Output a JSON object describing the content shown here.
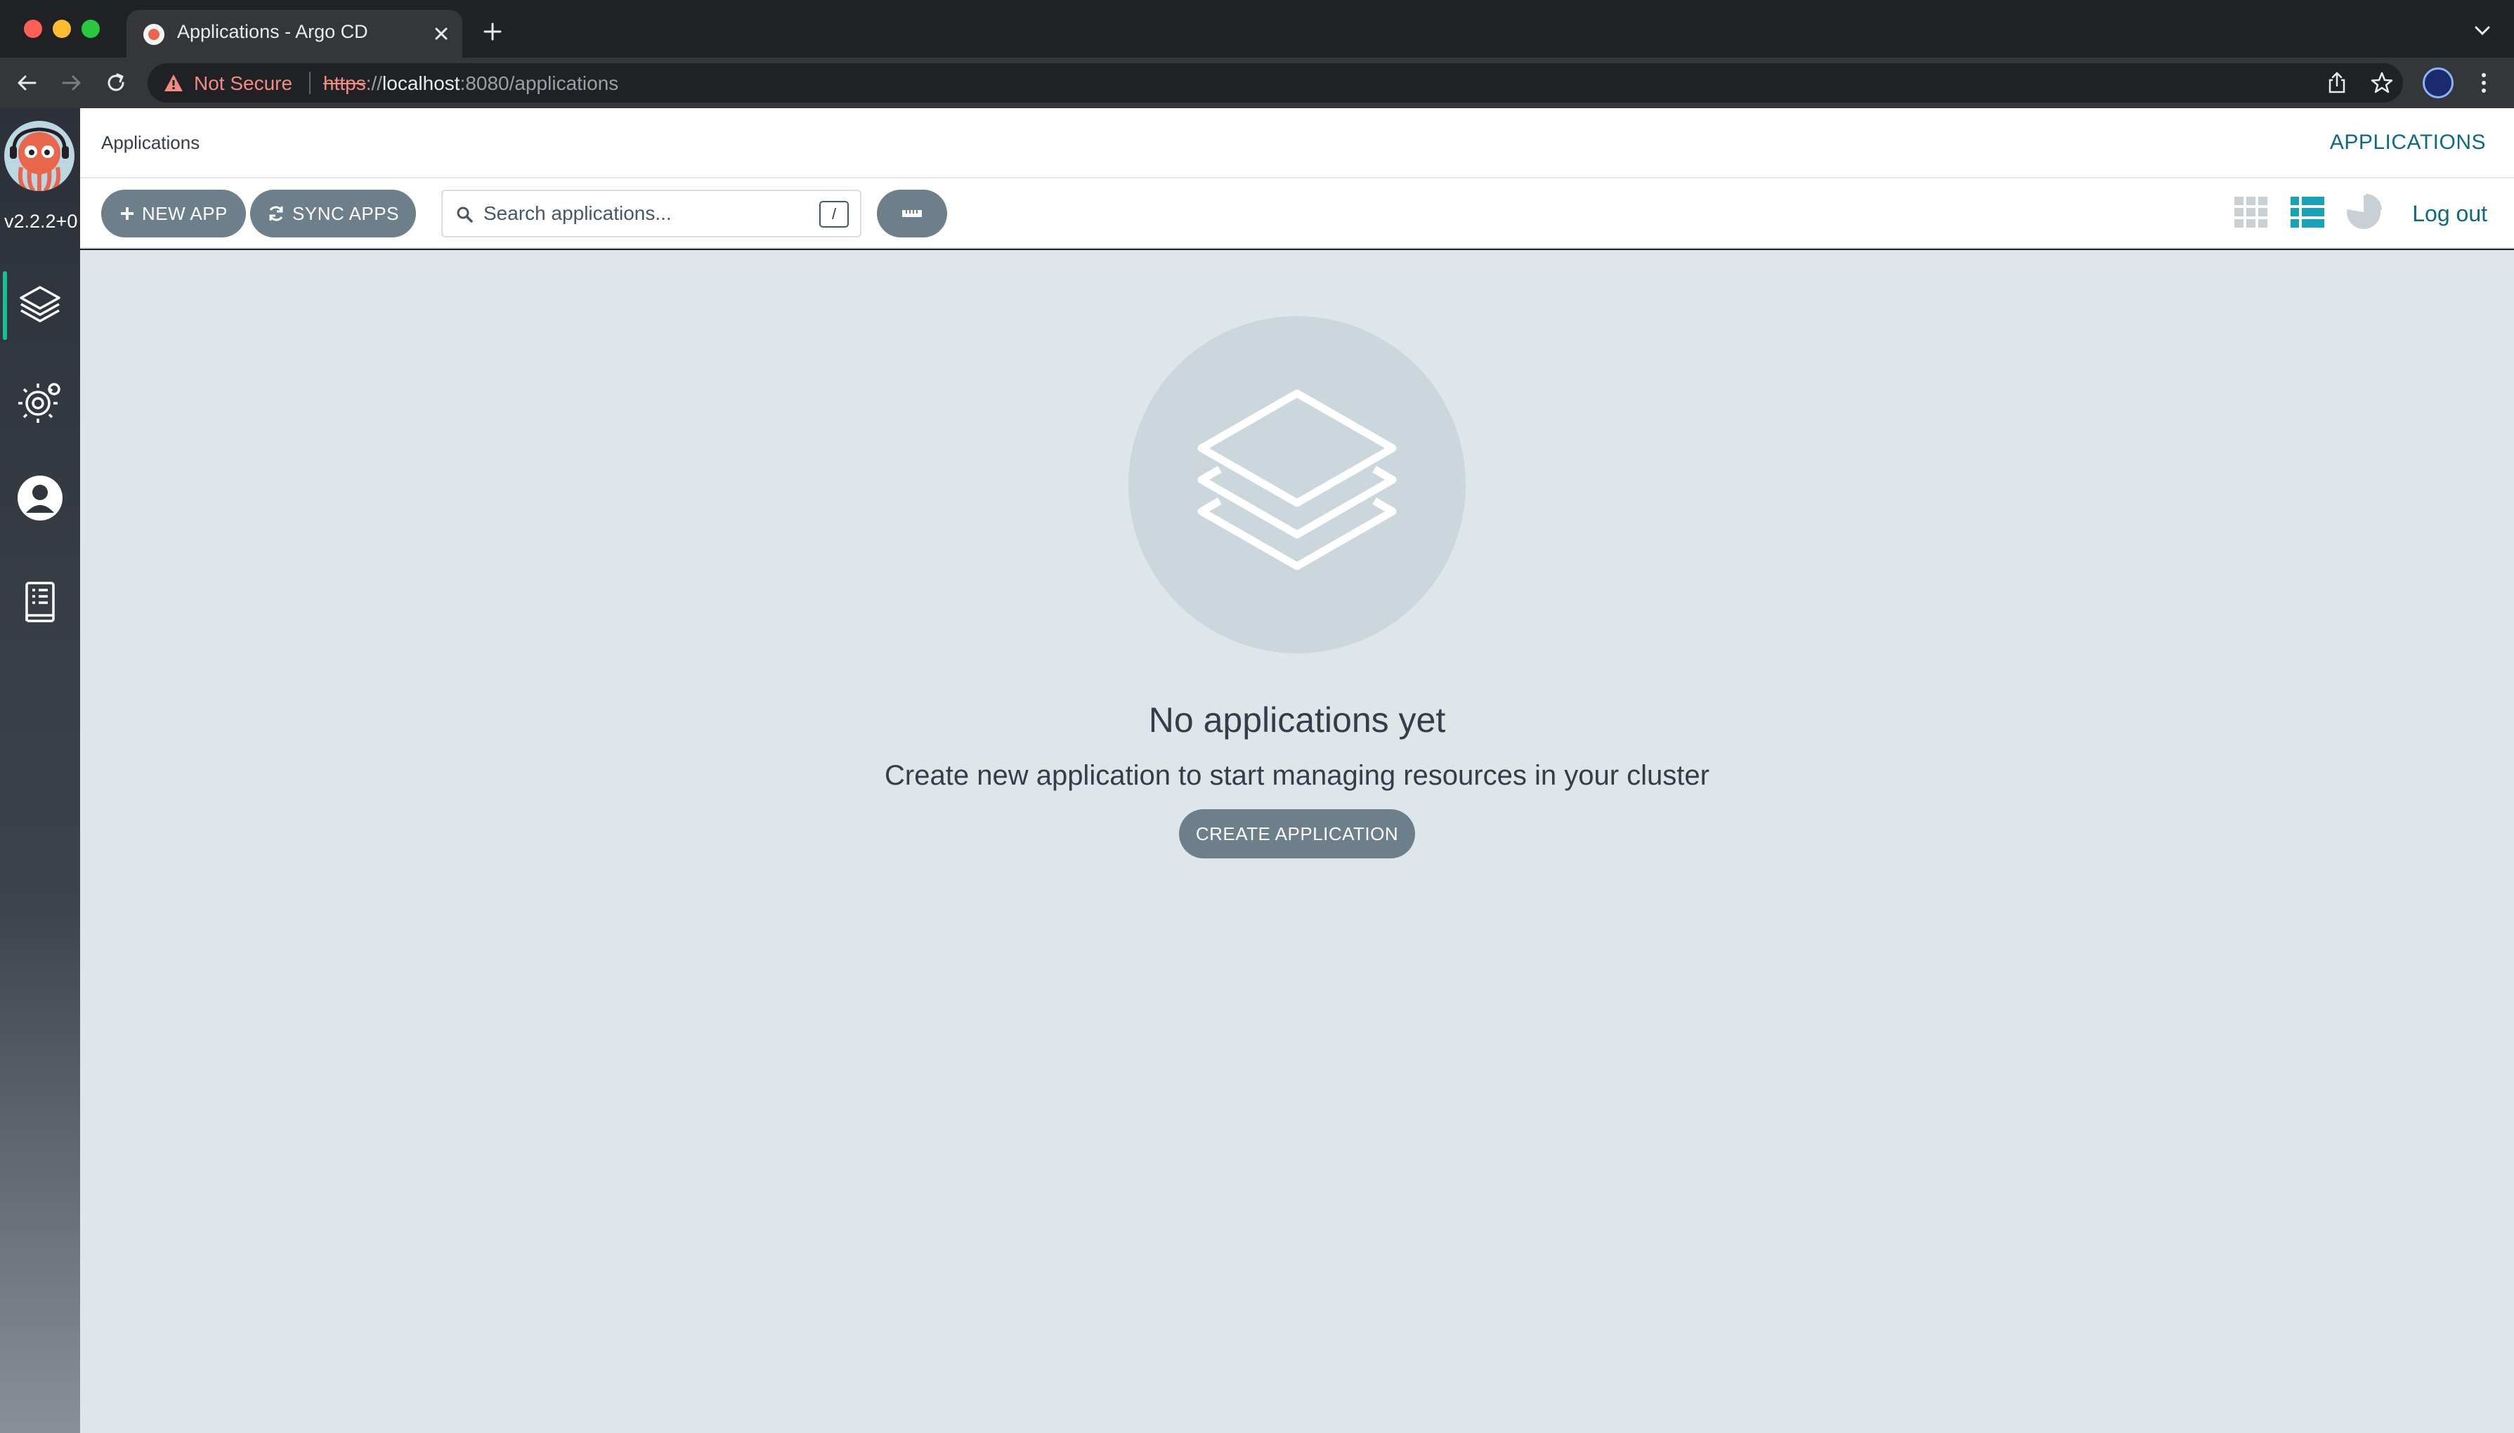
{
  "browser": {
    "tab_title": "Applications - Argo CD",
    "security_label": "Not Secure",
    "url": {
      "scheme": "https",
      "separator": "://",
      "host": "localhost",
      "rest": ":8080/applications"
    }
  },
  "sidebar": {
    "version": "v2.2.2+0",
    "items": [
      {
        "icon": "layers-icon",
        "label": "Applications",
        "active": true
      },
      {
        "icon": "gear-icon",
        "label": "Settings"
      },
      {
        "icon": "user-icon",
        "label": "User Info"
      },
      {
        "icon": "docs-icon",
        "label": "Documentation"
      }
    ]
  },
  "header": {
    "breadcrumb": "Applications",
    "title": "APPLICATIONS"
  },
  "toolbar": {
    "new_app_label": "NEW APP",
    "sync_apps_label": "SYNC APPS",
    "search_placeholder": "Search applications...",
    "search_shortcut": "/",
    "logout_label": "Log out",
    "active_view": "list"
  },
  "empty_state": {
    "title": "No applications yet",
    "subtitle": "Create new application to start managing resources in your cluster",
    "button_label": "CREATE APPLICATION"
  },
  "colors": {
    "accent": "#0c6b83",
    "button": "#6d7f8b",
    "background": "#dee6ea",
    "active_view_icon": "#17a2b8"
  }
}
